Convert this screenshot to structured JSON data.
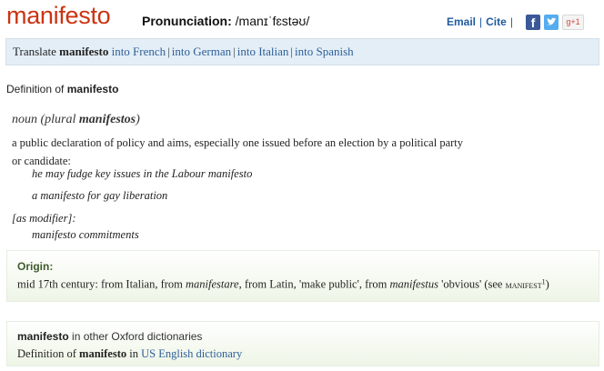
{
  "header": {
    "headword": "manifesto",
    "pronunciation_label": "Pronunciation:",
    "pronunciation": "/manɪˈfɛstəʊ/",
    "email_link": "Email",
    "cite_link": "Cite",
    "separator": "|",
    "social": {
      "facebook": "f",
      "twitter": "twitter-bird-icon",
      "gplus": "g+1"
    }
  },
  "translate": {
    "prefix": "Translate",
    "word": "manifesto",
    "links": [
      "into French",
      "into German",
      "into Italian",
      "into Spanish"
    ]
  },
  "definition": {
    "label": "Definition of",
    "word": "manifesto",
    "pos": "noun",
    "plural_prefix": "(plural",
    "plural_form": "manifestos",
    "plural_suffix": ")",
    "sense": "a public declaration of policy and aims, especially one issued before an election by a political party or candidate:",
    "examples": [
      "he may fudge key issues in the Labour manifesto",
      "a manifesto for gay liberation"
    ],
    "modifier_label": "[as modifier]:",
    "modifier_example": "manifesto commitments"
  },
  "origin": {
    "title": "Origin:",
    "text_1": "mid 17th century: from Italian, from ",
    "term_1": "manifestare",
    "text_2": ", from Latin, 'make public', from ",
    "term_2": "manifestus",
    "text_3": " 'obvious' (see ",
    "xref": "manifest",
    "xref_sup": "1",
    "text_4": ")"
  },
  "other": {
    "word": "manifesto",
    "title_suffix": " in other Oxford dictionaries",
    "link_prefix": "Definition of ",
    "link_word": "manifesto",
    "link_mid": " in ",
    "link_text": "US English dictionary"
  },
  "colors": {
    "headword": "#cc3311",
    "link": "#2d5f99",
    "translate_bg": "#e4eef6",
    "origin_bg": "#eef5e6"
  }
}
